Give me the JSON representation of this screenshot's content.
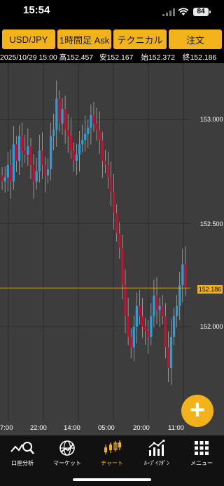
{
  "status_bar": {
    "time": "15:54",
    "battery": "84"
  },
  "toolbar": {
    "pair": "USD/JPY",
    "timeframe": "1時間足 Ask",
    "technical": "テクニカル",
    "order": "注文"
  },
  "ohlc": {
    "datetime": "2025/10/29 15:00",
    "high_label": "高",
    "high": "152.457",
    "low_label": "安",
    "low": "152.167",
    "open_label": "始",
    "open": "152.372",
    "close_label": "終",
    "close": "152.186"
  },
  "chart": {
    "up_color": "#2a9fd6",
    "down_color": "#c8102e",
    "current_price_line_color": "#f2b21a",
    "y_ticks": [
      "153.000",
      "152.500",
      "152.186",
      "152.000"
    ],
    "current_price": "152.186",
    "x_ticks": [
      "7:00",
      "22:00",
      "14:00",
      "05:00",
      "20:00",
      "11:00"
    ]
  },
  "fab": {
    "label": "+"
  },
  "tabs": [
    {
      "label": "口座分析",
      "icon": "account-analysis-icon"
    },
    {
      "label": "マーケット",
      "icon": "market-globe-icon"
    },
    {
      "label": "チャート",
      "icon": "chart-candle-icon",
      "active": true
    },
    {
      "label": "ﾙｰﾌﾟｲﾌﾀﾞﾝ",
      "icon": "loop-ifd-icon"
    },
    {
      "label": "メニュー",
      "icon": "menu-grid-icon"
    }
  ]
}
